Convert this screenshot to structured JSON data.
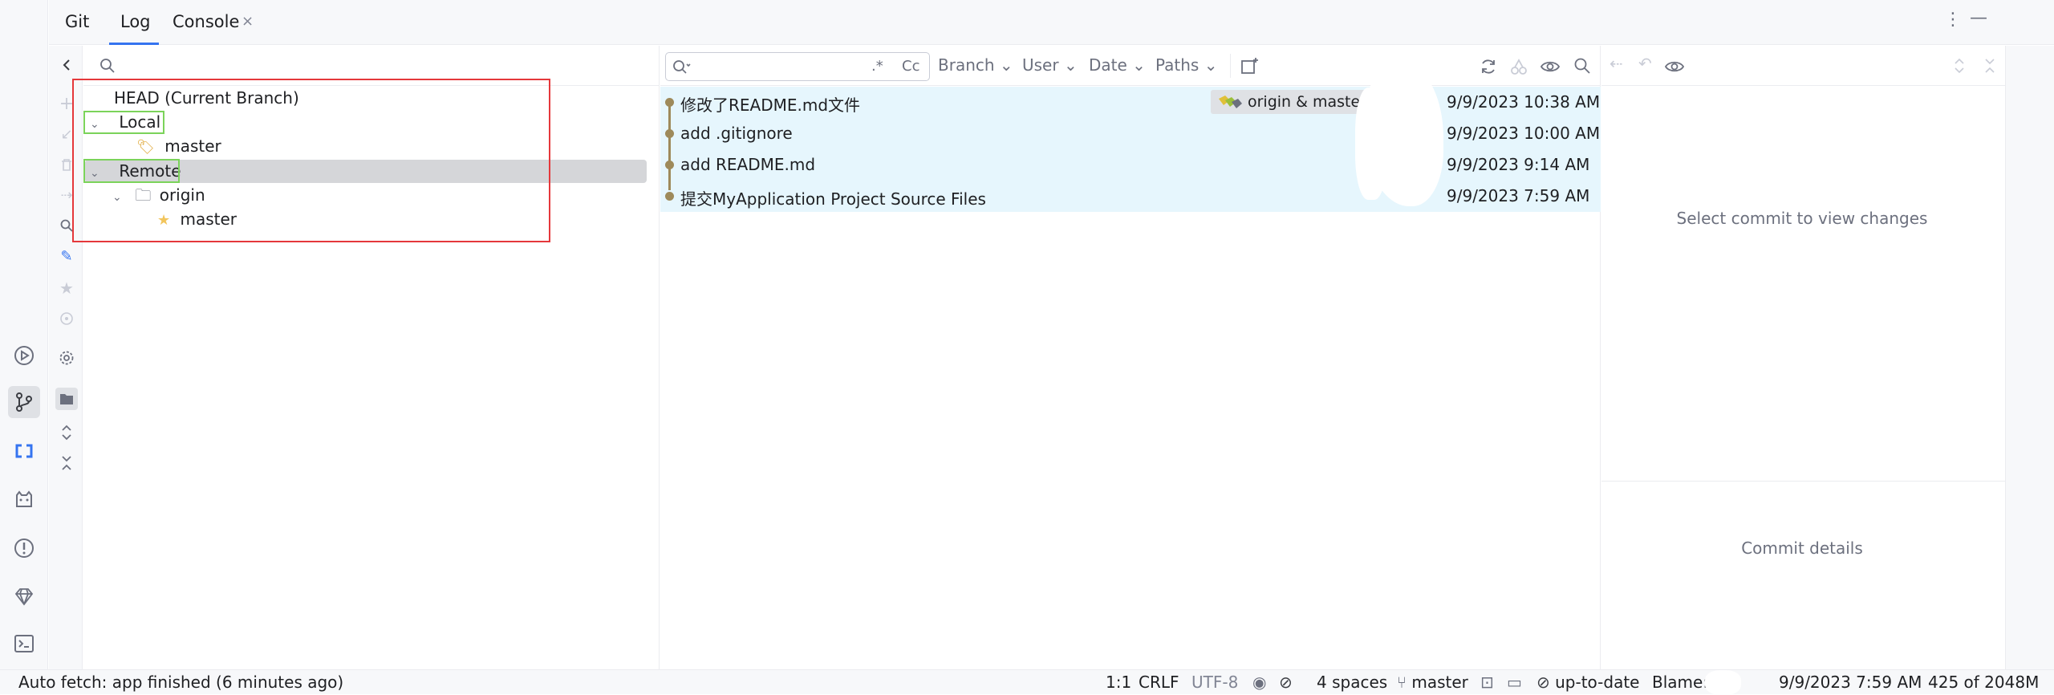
{
  "header": {
    "title": "Git",
    "tabs": [
      {
        "label": "Log"
      },
      {
        "label": "Console"
      }
    ]
  },
  "branches": {
    "search_placeholder": "",
    "head_label": "HEAD (Current Branch)",
    "local_label": "Local",
    "local_master": "master",
    "remote_label": "Remote",
    "origin_label": "origin",
    "remote_master": "master"
  },
  "log": {
    "search_regex": ".*",
    "search_case": "Cc",
    "filters": [
      "Branch",
      "User",
      "Date",
      "Paths"
    ],
    "commits": [
      {
        "message": "修改了README.md文件",
        "refs": "origin & master",
        "date": "9/9/2023 10:38 AM"
      },
      {
        "message": "add .gitignore",
        "refs": "",
        "date": "9/9/2023 10:00 AM"
      },
      {
        "message": "add README.md",
        "refs": "",
        "date": "9/9/2023 9:14 AM"
      },
      {
        "message": "提交MyApplication Project Source Files",
        "refs": "",
        "date": "9/9/2023 7:59 AM"
      }
    ]
  },
  "details": {
    "changes_placeholder": "Select commit to view changes",
    "details_placeholder": "Commit details"
  },
  "status_bar": {
    "message": "Auto fetch: app finished (6 minutes ago)",
    "position": "1:1",
    "line_ending": "CRLF",
    "encoding": "UTF-8",
    "indent": "4 spaces",
    "branch": "master",
    "vcs_status": "up-to-date",
    "blame": "Blame:",
    "blame_date": "9/9/2023 7:59 AM",
    "memory": "425 of 2048M"
  },
  "colors": {
    "accent": "#3574f0",
    "selection_row": "#e6f6fd",
    "highlight_red": "#e5383b",
    "highlight_green": "#7bd35a",
    "graph": "#9e8a5b"
  }
}
